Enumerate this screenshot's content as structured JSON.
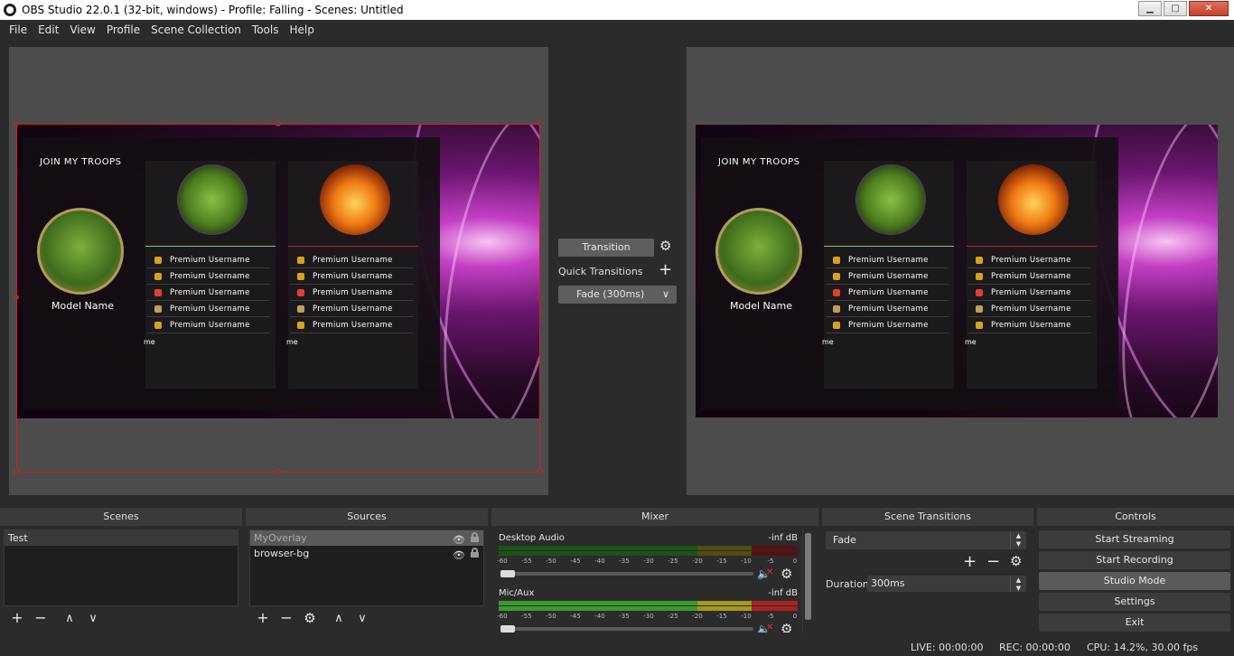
{
  "window": {
    "title": "OBS Studio 22.0.1 (32-bit, windows) - Profile: Falling - Scenes: Untitled",
    "minimize": "▁",
    "maximize": "□",
    "close": "✕"
  },
  "menu": [
    "File",
    "Edit",
    "View",
    "Profile",
    "Scene Collection",
    "Tools",
    "Help"
  ],
  "overlay": {
    "join": "JOIN MY TROOPS",
    "model_name": "Model Name",
    "rows": [
      "Premium Username",
      "Premium Username",
      "Premium Username",
      "Premium Username",
      "Premium Username"
    ],
    "row_colors": [
      "#d9a21c",
      "#d9a21c",
      "#e0402a",
      "#bfa052",
      "#d9a21c"
    ],
    "cut_text": "me"
  },
  "transition": {
    "button": "Transition",
    "quick_label": "Quick Transitions",
    "fade": "Fade (300ms)"
  },
  "docks": {
    "scenes": "Scenes",
    "sources": "Sources",
    "mixer": "Mixer",
    "scene_transitions": "Scene Transitions",
    "controls": "Controls"
  },
  "scenes": [
    "Test"
  ],
  "sources": [
    {
      "name": "MyOverlay",
      "selected": true
    },
    {
      "name": "browser-bg",
      "selected": false
    }
  ],
  "mixer": {
    "channels": [
      {
        "name": "Desktop Audio",
        "db": "-inf dB"
      },
      {
        "name": "Mic/Aux",
        "db": "-inf dB"
      }
    ],
    "ticks": [
      "-60",
      "-55",
      "-50",
      "-45",
      "-40",
      "-35",
      "-30",
      "-25",
      "-20",
      "-15",
      "-10",
      "-5",
      "0"
    ]
  },
  "scene_transitions": {
    "selected": "Fade",
    "duration_label": "Duration",
    "duration_value": "300ms"
  },
  "controls": [
    "Start Streaming",
    "Start Recording",
    "Studio Mode",
    "Settings",
    "Exit"
  ],
  "status": {
    "live": "LIVE: 00:00:00",
    "rec": "REC: 00:00:00",
    "cpu": "CPU: 14.2%, 30.00 fps"
  },
  "icons": {
    "plus": "+",
    "minus": "−",
    "up": "∧",
    "down": "∨",
    "gear": "⚙",
    "eye": "👁",
    "chevron": "∨",
    "speaker": "🔈",
    "x": "✕",
    "up_small": "▲",
    "down_small": "▼"
  }
}
